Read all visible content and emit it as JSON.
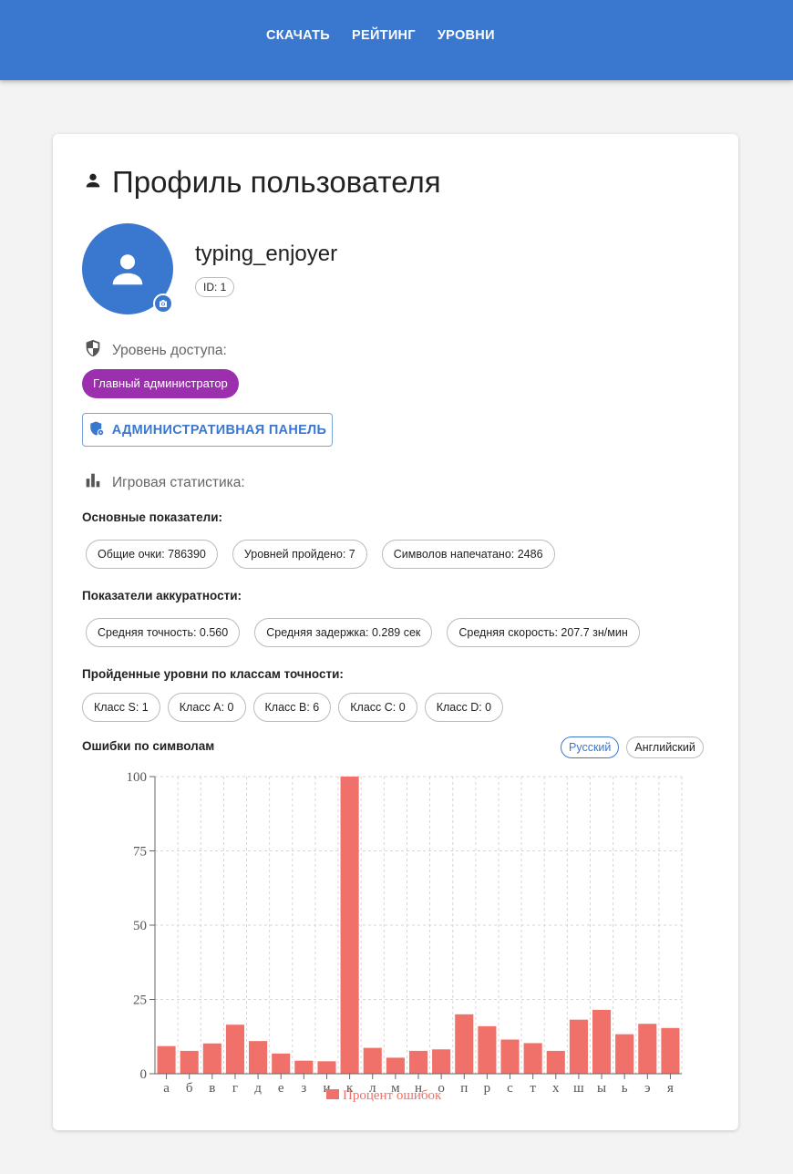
{
  "nav": {
    "items": [
      "СКАЧАТЬ",
      "РЕЙТИНГ",
      "УРОВНИ"
    ]
  },
  "profile": {
    "title": "Профиль пользователя",
    "username": "typing_enjoyer",
    "id_label": "ID: 1",
    "access_label": "Уровень доступа:",
    "role": "Главный администратор",
    "admin_button": "АДМИНИСТРАТИВНАЯ ПАНЕЛЬ",
    "stats_label": "Игровая статистика:"
  },
  "stats": {
    "main_title": "Основные показатели:",
    "main": [
      "Общие очки: 786390",
      "Уровней пройдено: 7",
      "Символов напечатано: 2486"
    ],
    "accuracy_title": "Показатели аккуратности:",
    "accuracy": [
      "Средняя точность: 0.560",
      "Средняя задержка: 0.289 сек",
      "Средняя скорость: 207.7 зн/мин"
    ],
    "classes_title": "Пройденные уровни по классам точности:",
    "classes": [
      "Класс S: 1",
      "Класс A: 0",
      "Класс B: 6",
      "Класс C: 0",
      "Класс D: 0"
    ]
  },
  "errors": {
    "title": "Ошибки по символам",
    "languages": [
      "Русский",
      "Английский"
    ],
    "active_language": "Русский"
  },
  "colors": {
    "accent": "#3a78d0",
    "role": "#9b2fae",
    "bar": "#f0706a"
  },
  "chart_data": {
    "type": "bar",
    "categories": [
      "а",
      "б",
      "в",
      "г",
      "д",
      "е",
      "з",
      "и",
      "к",
      "л",
      "м",
      "н",
      "о",
      "п",
      "р",
      "с",
      "т",
      "х",
      "ш",
      "ы",
      "ь",
      "э",
      "я"
    ],
    "series": [
      {
        "name": "Процент ошибок",
        "values": [
          9.3,
          7.7,
          10.2,
          16.5,
          11,
          6.8,
          4.4,
          4.2,
          100,
          8.7,
          5.4,
          7.7,
          8.2,
          20,
          16,
          11.5,
          10.3,
          7.7,
          18.2,
          21.5,
          13.3,
          16.8,
          15.4
        ]
      }
    ],
    "yticks": [
      0,
      25,
      50,
      75,
      100
    ],
    "ylim": [
      0,
      100
    ],
    "grid": true,
    "legend": "bottom"
  }
}
